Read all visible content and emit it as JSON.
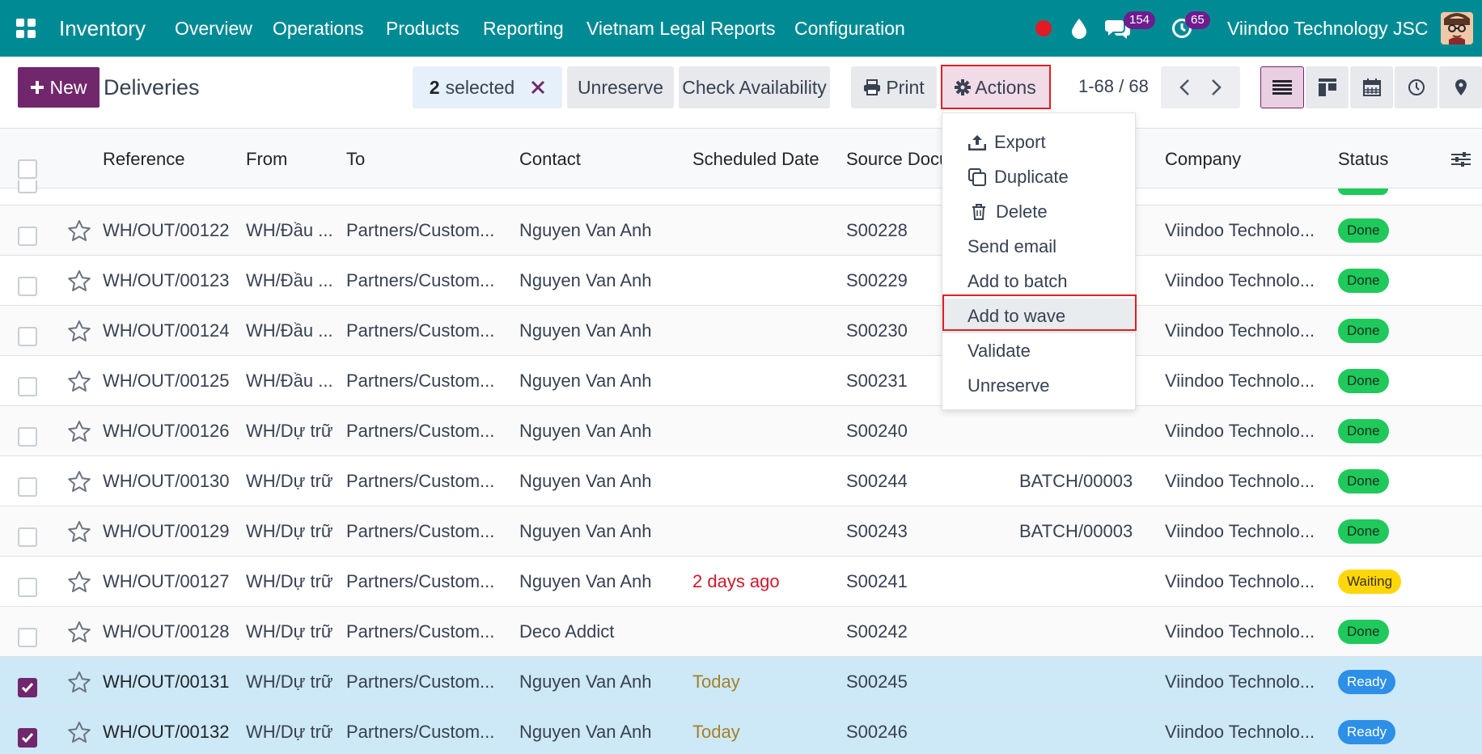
{
  "navbar": {
    "app_name": "Inventory",
    "menu": [
      "Overview",
      "Operations",
      "Products",
      "Reporting",
      "Vietnam Legal Reports",
      "Configuration"
    ],
    "messages_count": "154",
    "activities_count": "65",
    "company": "Viindoo Technology JSC"
  },
  "control_panel": {
    "new_label": "New",
    "breadcrumb": "Deliveries",
    "selected_count": "2",
    "selected_label": "selected",
    "unreserve_label": "Unreserve",
    "check_availability_label": "Check Availability",
    "print_label": "Print",
    "actions_label": "Actions",
    "pager": "1-68 / 68"
  },
  "table": {
    "headers": {
      "reference": "Reference",
      "from": "From",
      "to": "To",
      "contact": "Contact",
      "scheduled_date": "Scheduled Date",
      "source_document": "Source Docu",
      "company": "Company",
      "status": "Status"
    },
    "rows": [
      {
        "ref": "WH/OUT/00122",
        "from": "WH/Đầu ...",
        "to": "Partners/Custom...",
        "contact": "Nguyen Van Anh",
        "date": "",
        "source": "S00228",
        "batch": "",
        "company": "Viindoo Technolo...",
        "status": "Done",
        "checked": false
      },
      {
        "ref": "WH/OUT/00123",
        "from": "WH/Đầu ...",
        "to": "Partners/Custom...",
        "contact": "Nguyen Van Anh",
        "date": "",
        "source": "S00229",
        "batch": "",
        "company": "Viindoo Technolo...",
        "status": "Done",
        "checked": false
      },
      {
        "ref": "WH/OUT/00124",
        "from": "WH/Đầu ...",
        "to": "Partners/Custom...",
        "contact": "Nguyen Van Anh",
        "date": "",
        "source": "S00230",
        "batch": "",
        "company": "Viindoo Technolo...",
        "status": "Done",
        "checked": false
      },
      {
        "ref": "WH/OUT/00125",
        "from": "WH/Đầu ...",
        "to": "Partners/Custom...",
        "contact": "Nguyen Van Anh",
        "date": "",
        "source": "S00231",
        "batch": "",
        "company": "Viindoo Technolo...",
        "status": "Done",
        "checked": false
      },
      {
        "ref": "WH/OUT/00126",
        "from": "WH/Dự trữ",
        "to": "Partners/Custom...",
        "contact": "Nguyen Van Anh",
        "date": "",
        "source": "S00240",
        "batch": "",
        "company": "Viindoo Technolo...",
        "status": "Done",
        "checked": false
      },
      {
        "ref": "WH/OUT/00130",
        "from": "WH/Dự trữ",
        "to": "Partners/Custom...",
        "contact": "Nguyen Van Anh",
        "date": "",
        "source": "S00244",
        "batch": "BATCH/00003",
        "company": "Viindoo Technolo...",
        "status": "Done",
        "checked": false
      },
      {
        "ref": "WH/OUT/00129",
        "from": "WH/Dự trữ",
        "to": "Partners/Custom...",
        "contact": "Nguyen Van Anh",
        "date": "",
        "source": "S00243",
        "batch": "BATCH/00003",
        "company": "Viindoo Technolo...",
        "status": "Done",
        "checked": false
      },
      {
        "ref": "WH/OUT/00127",
        "from": "WH/Dự trữ",
        "to": "Partners/Custom...",
        "contact": "Nguyen Van Anh",
        "date": "2 days ago",
        "source": "S00241",
        "batch": "",
        "company": "Viindoo Technolo...",
        "status": "Waiting",
        "checked": false
      },
      {
        "ref": "WH/OUT/00128",
        "from": "WH/Dự trữ",
        "to": "Partners/Custom...",
        "contact": "Deco Addict",
        "date": "",
        "source": "S00242",
        "batch": "",
        "company": "Viindoo Technolo...",
        "status": "Done",
        "checked": false
      },
      {
        "ref": "WH/OUT/00131",
        "from": "WH/Dự trữ",
        "to": "Partners/Custom...",
        "contact": "Nguyen Van Anh",
        "date": "Today",
        "source": "S00245",
        "batch": "",
        "company": "Viindoo Technolo...",
        "status": "Ready",
        "checked": true
      },
      {
        "ref": "WH/OUT/00132",
        "from": "WH/Dự trữ",
        "to": "Partners/Custom...",
        "contact": "Nguyen Van Anh",
        "date": "Today",
        "source": "S00246",
        "batch": "",
        "company": "Viindoo Technolo...",
        "status": "Ready",
        "checked": true
      }
    ]
  },
  "actions_menu": {
    "items": [
      "Export",
      "Duplicate",
      "Delete",
      "Send email",
      "Add to batch",
      "Add to wave",
      "Validate",
      "Unreserve"
    ],
    "highlighted": "Add to wave"
  },
  "colors": {
    "navbar": "#008b94",
    "brand": "#71276b",
    "done": "#1fc95b",
    "waiting": "#ffd60a",
    "ready": "#2d8fe6",
    "overdue": "#d0182b",
    "today": "#a5802a",
    "highlight_box": "#e02020"
  }
}
